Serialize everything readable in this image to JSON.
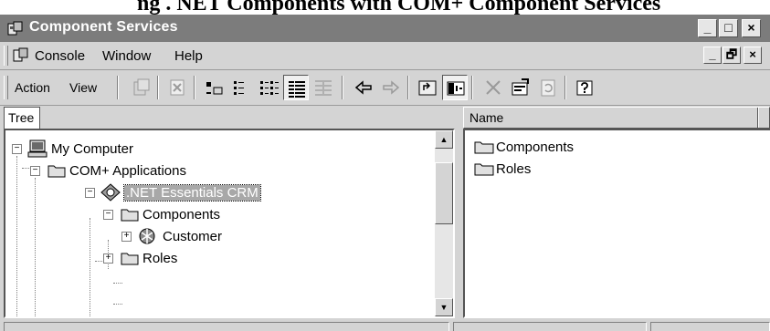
{
  "caption": "ng . NET Components with COM+ Component Services",
  "window": {
    "title": "Component Services",
    "caption_buttons": {
      "minimize": "_",
      "maximize": "□",
      "close": "×"
    }
  },
  "menubar": {
    "items": [
      {
        "label": "Console"
      },
      {
        "label": "Window"
      },
      {
        "label": "Help"
      }
    ],
    "mdi_buttons": {
      "minimize": "_",
      "restore": "🗗",
      "close": "×"
    }
  },
  "toolbar": {
    "action_label": "Action",
    "view_label": "View",
    "buttons": [
      "new-window-icon",
      "delete-icon",
      "large-icons-icon",
      "small-icons-icon",
      "list-view-icon",
      "details-view-icon",
      "disabled-view-icon",
      "back-arrow-icon",
      "forward-arrow-icon",
      "up-folder-icon",
      "show-hide-tree-icon",
      "delete-x-icon",
      "properties-icon",
      "refresh-icon",
      "help-icon"
    ]
  },
  "tree": {
    "tab_label": "Tree",
    "nodes": [
      {
        "label": "My Computer",
        "expanded": true,
        "icon": "computer-icon"
      },
      {
        "label": "COM+ Applications",
        "expanded": true,
        "icon": "folder-icon"
      },
      {
        "label": ".NET Essentials CRM",
        "expanded": true,
        "icon": "com-app-icon",
        "selected": true
      },
      {
        "label": "Components",
        "expanded": true,
        "icon": "folder-icon"
      },
      {
        "label": "Customer",
        "expanded": false,
        "icon": "component-icon"
      },
      {
        "label": "Roles",
        "expanded": false,
        "icon": "folder-icon"
      }
    ]
  },
  "list": {
    "column_header": "Name",
    "items": [
      {
        "label": "Components",
        "icon": "folder-icon"
      },
      {
        "label": "Roles",
        "icon": "folder-icon"
      }
    ]
  },
  "colors": {
    "titlebar": "#7c7c7c",
    "face": "#d4d4d4",
    "selection": "#a8a8a8"
  }
}
